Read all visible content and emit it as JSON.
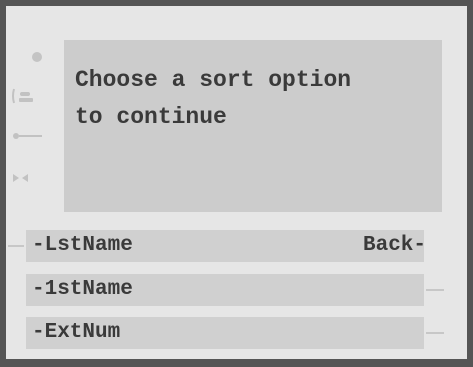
{
  "screen": {
    "message": "Choose a sort option\nto continue"
  },
  "side_icons": [
    "status-dot-icon",
    "phone-handset-icon",
    "key-icon",
    "mute-icon"
  ],
  "softkeys": {
    "row1_left": "-LstName",
    "row1_right": "Back-",
    "row2_left": "-1stName",
    "row3_left": "-ExtNum"
  },
  "colors": {
    "frame": "#555555",
    "screen_bg": "#e6e6e6",
    "message_bg": "#cccccc",
    "softkey_bg": "#d0d0d0",
    "text": "#3a3a3a"
  }
}
